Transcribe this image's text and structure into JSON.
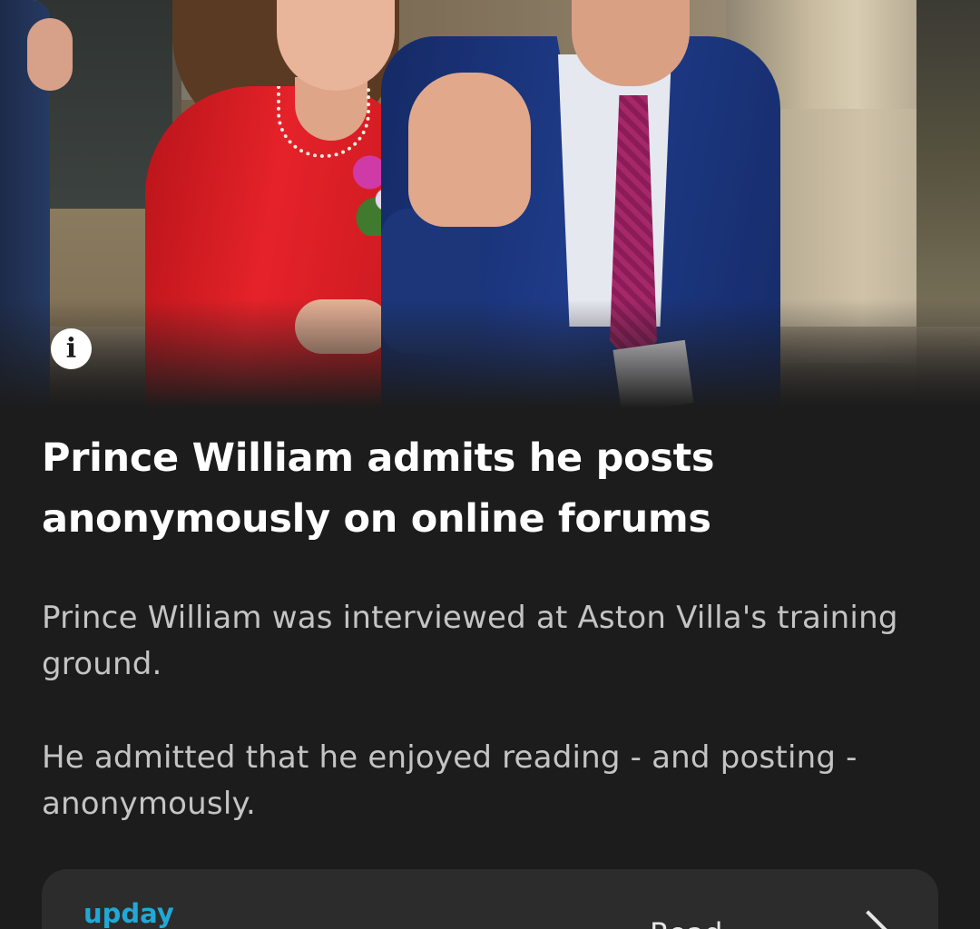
{
  "article": {
    "headline": "Prince William admits he posts anonymously on online forums",
    "summary": [
      "Prince William was interviewed at Aston Villa's training ground.",
      "He admitted that he enjoyed reading - and posting - anonymously."
    ],
    "info_icon_glyph": "i"
  },
  "source_card": {
    "source_name": "upday",
    "action_label": "Read",
    "action_icon": "chevron-right-icon"
  },
  "colors": {
    "background": "#1c1c1c",
    "card": "#2c2c2c",
    "source_accent": "#21a8d6"
  }
}
